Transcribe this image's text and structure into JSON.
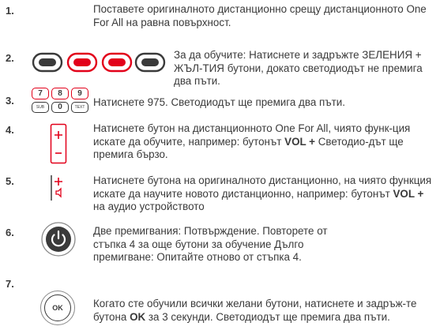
{
  "steps": [
    {
      "num": "1.",
      "text": "Поставете оригиналното дистанционно срещу дистанционното One For All на равна повърхност."
    },
    {
      "num": "2.",
      "text": "За да обучите: Натиснете и задръжте ЗЕЛЕНИЯ + ЖЪЛ-ТИЯ бутони, докато светодиодът не премига два пъти."
    },
    {
      "num": "3.",
      "text": "Натиснете 975. Светодиодът ще премига два пъти.",
      "keys_top": [
        "7",
        "8",
        "9"
      ],
      "keys_bottom": [
        "SUB",
        "0",
        "TEXT"
      ]
    },
    {
      "num": "4.",
      "text_before": "Натиснете бутон на дистанционното One For All, чиято функ-ция искате да обучите, например: бутонът ",
      "bold": "VOL +",
      "text_after": " Светодио-дът ще премига бързо."
    },
    {
      "num": "5.",
      "text_before": "Натиснете бутона на оригиналното дистанционно, на чиято функция искате да научите новото дистанционно, например: бутонът ",
      "bold": "VOL +",
      "text_after": " на аудио устройството"
    },
    {
      "num": "6.",
      "text": "Две премигвания: Потвърждение. Повторете от стъпка 4 за още бутони за обучение Дълго премигване: Опитайте отново от стъпка 4."
    },
    {
      "num": "7.",
      "text_before": "Когато сте обучили всички желани бутони, натиснете и задръж-те бутона ",
      "bold": "OK",
      "text_after": " за 3 секунди. Светодиодът ще премига два пъти.",
      "ok_label": "OK"
    }
  ],
  "colors": {
    "red": "#e2001a",
    "dark": "#3a3a3a",
    "border": "#8a8a8a"
  }
}
